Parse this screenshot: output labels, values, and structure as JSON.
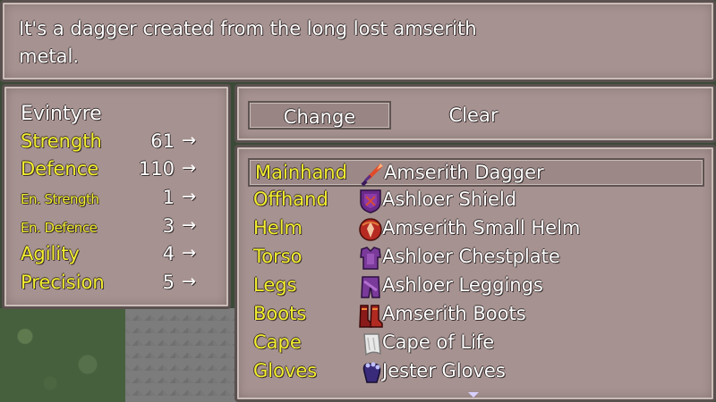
{
  "description": {
    "text": "It's a dagger created from the long lost amserith metal."
  },
  "stats": {
    "character_name": "Evintyre",
    "rows": [
      {
        "label": "Strength",
        "value": "61",
        "arrow": "→",
        "small": false
      },
      {
        "label": "Defence",
        "value": "110",
        "arrow": "→",
        "small": false
      },
      {
        "label": "En. Strength",
        "value": "1",
        "arrow": "→",
        "small": true
      },
      {
        "label": "En. Defence",
        "value": "3",
        "arrow": "→",
        "small": true
      },
      {
        "label": "Agility",
        "value": "4",
        "arrow": "→",
        "small": false
      },
      {
        "label": "Precision",
        "value": "5",
        "arrow": "→",
        "small": false
      }
    ]
  },
  "commands": {
    "change_label": "Change",
    "clear_label": "Clear",
    "selected": "Change"
  },
  "equipment": {
    "selected_index": 0,
    "slots": [
      {
        "slot": "Mainhand",
        "item": "Amserith Dagger",
        "icon": "dagger-icon"
      },
      {
        "slot": "Offhand",
        "item": "Ashloer Shield",
        "icon": "shield-icon"
      },
      {
        "slot": "Helm",
        "item": "Amserith Small Helm",
        "icon": "helm-icon"
      },
      {
        "slot": "Torso",
        "item": "Ashloer Chestplate",
        "icon": "chestplate-icon"
      },
      {
        "slot": "Legs",
        "item": "Ashloer Leggings",
        "icon": "leggings-icon"
      },
      {
        "slot": "Boots",
        "item": "Amserith Boots",
        "icon": "boots-icon"
      },
      {
        "slot": "Cape",
        "item": "Cape of Life",
        "icon": "cape-icon"
      },
      {
        "slot": "Gloves",
        "item": "Jester Gloves",
        "icon": "gloves-icon"
      }
    ]
  },
  "colors": {
    "panel": "#a69290",
    "label_yellow": "#f4ef2e",
    "text_white": "#ffffff"
  }
}
